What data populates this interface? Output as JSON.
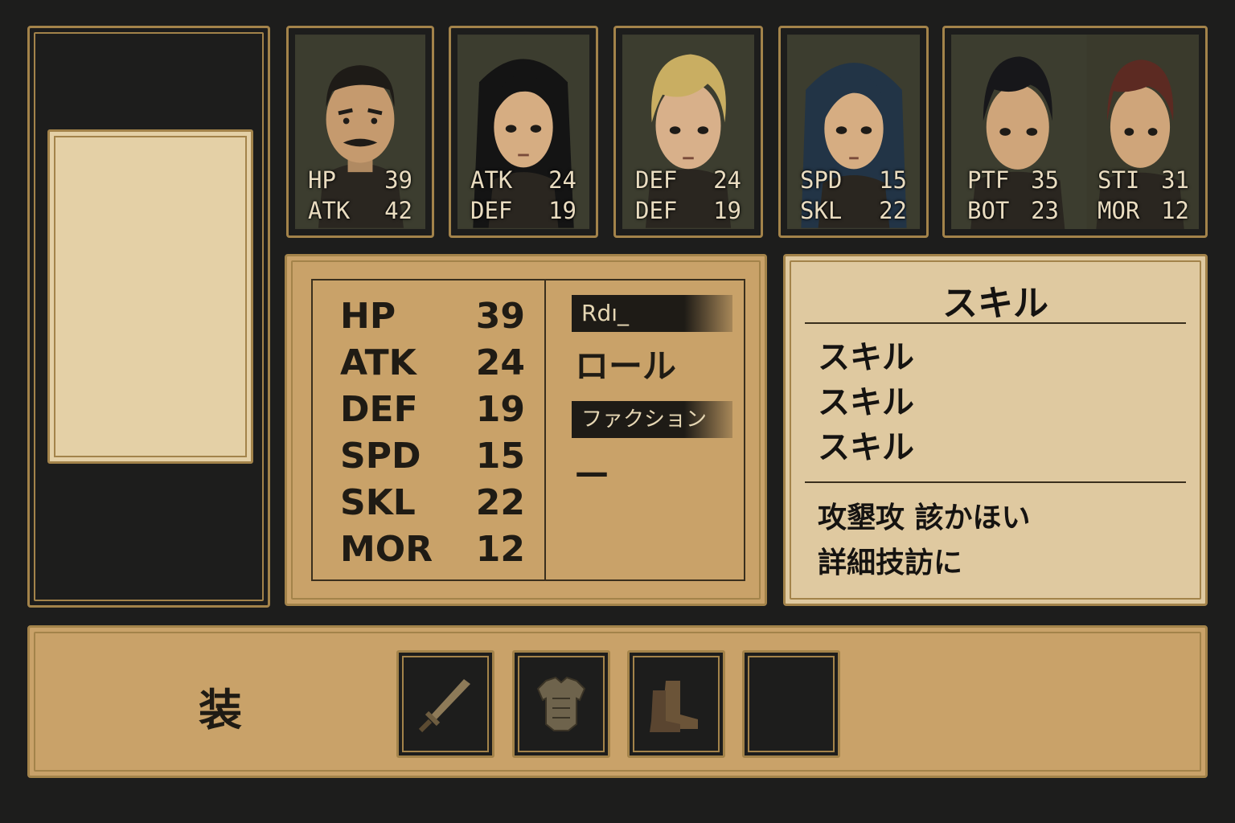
{
  "characters": [
    {
      "id": "mustached-officer",
      "stats": [
        {
          "label": "HP",
          "value": "39"
        },
        {
          "label": "ATK",
          "value": "42"
        }
      ]
    },
    {
      "id": "black-haired-woman",
      "stats": [
        {
          "label": "ATK",
          "value": "24"
        },
        {
          "label": "DEF",
          "value": "19"
        }
      ]
    },
    {
      "id": "blond-soldier",
      "stats": [
        {
          "label": "DEF",
          "value": "24"
        },
        {
          "label": "DEF",
          "value": "19"
        }
      ]
    },
    {
      "id": "blue-haired-woman",
      "stats": [
        {
          "label": "SPD",
          "value": "15"
        },
        {
          "label": "SKL",
          "value": "22"
        }
      ]
    },
    {
      "id": "pair-soldiers",
      "stats": [
        {
          "label": "PTF",
          "value": "35"
        },
        {
          "label": "BOT",
          "value": "23"
        },
        {
          "label": "STI",
          "value": "31"
        },
        {
          "label": "MOR",
          "value": "12"
        }
      ]
    }
  ],
  "stats_panel": {
    "stats": [
      {
        "label": "HP",
        "value": "39"
      },
      {
        "label": "ATK",
        "value": "24"
      },
      {
        "label": "DEF",
        "value": "19"
      },
      {
        "label": "SPD",
        "value": "15"
      },
      {
        "label": "SKL",
        "value": "22"
      },
      {
        "label": "MOR",
        "value": "12"
      }
    ],
    "role_label": "Rdı_",
    "role_value": "ロール",
    "faction_label": "ファクション",
    "faction_value": "—"
  },
  "skill_panel": {
    "title": "スキル",
    "skills": [
      "スキル",
      "スキル",
      "スキル"
    ],
    "description": [
      "攻墾攻 該かほい",
      "詳細技訪に"
    ]
  },
  "equipment": {
    "label": "装",
    "slots": [
      {
        "icon": "sword-icon"
      },
      {
        "icon": "armor-icon"
      },
      {
        "icon": "boots-icon"
      },
      {
        "icon": "empty-slot"
      }
    ]
  },
  "colors": {
    "background": "#1d1d1c",
    "gold_border": "#a3834a",
    "panel_tan": "#c9a269",
    "panel_paper": "#dfc9a0",
    "text_dark": "#1f1b14",
    "text_light": "#e9dcc0"
  }
}
